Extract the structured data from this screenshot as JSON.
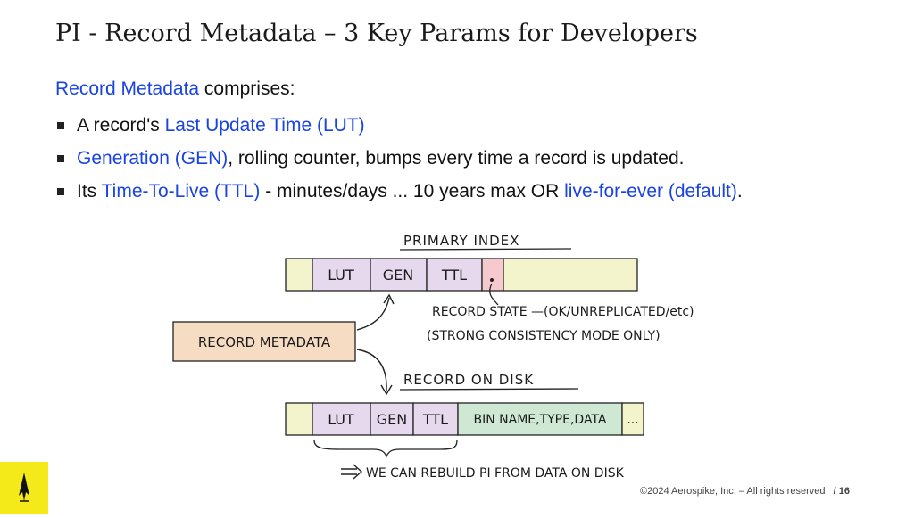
{
  "slide": {
    "title": "PI - Record Metadata – 3 Key Params for Developers",
    "intro_highlight": "Record Metadata",
    "intro_rest": " comprises:",
    "bullets": [
      {
        "pre": "A record's ",
        "hl": "Last Update Time (LUT)",
        "post": ""
      },
      {
        "pre": "",
        "hl": "Generation (GEN)",
        "post": ", rolling counter, bumps every time a record is updated."
      },
      {
        "pre": "Its ",
        "hl": "Time-To-Live (TTL)",
        "post": " -  minutes/days ... 10 years max OR ",
        "hl2": "live-for-ever (default)",
        "post2": "."
      }
    ]
  },
  "diagram": {
    "primary_index_label": "PRIMARY INDEX",
    "pi_cells": [
      "LUT",
      "GEN",
      "TTL"
    ],
    "record_state": "RECORD STATE —(OK/UNREPLICATED/etc)",
    "strong_consistency": "(STRONG CONSISTENCY MODE ONLY)",
    "record_metadata_box": "RECORD METADATA",
    "record_on_disk_label": "RECORD ON DISK",
    "disk_cells": [
      "LUT",
      "GEN",
      "TTL"
    ],
    "bin_text": "BIN NAME,TYPE,DATA",
    "ellipsis": "...",
    "rebuild_note": "WE CAN REBUILD PI FROM DATA ON DISK",
    "colors": {
      "metadata": "#e6d9ee",
      "yellow": "#f3f3cc",
      "pink": "#f6c9cf",
      "orange": "#f6dcc3",
      "green": "#cfe8d3"
    }
  },
  "footer": {
    "copyright": "©2024 Aerospike, Inc. – All rights reserved",
    "page": "/ 16"
  }
}
